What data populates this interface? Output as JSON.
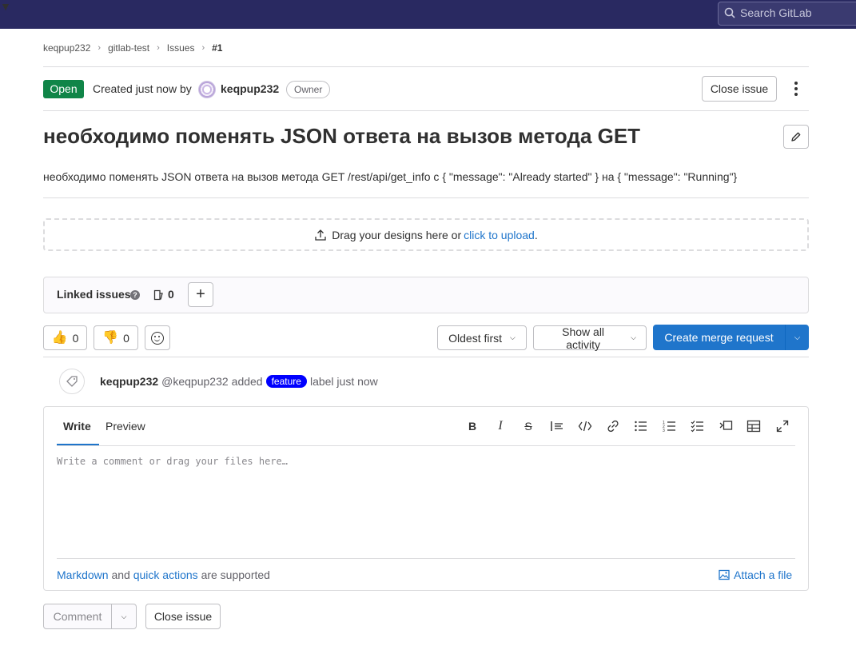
{
  "topbar": {
    "new_icon": "plus-square-icon",
    "search_placeholder": "Search GitLab"
  },
  "breadcrumb": [
    "keqpup232",
    "gitlab-test",
    "Issues",
    "#1"
  ],
  "issue": {
    "status": "Open",
    "created_text": "Created just now by",
    "author": "keqpup232",
    "role": "Owner",
    "close_label": "Close issue",
    "title": "необходимо поменять JSON ответа на вызов метода GET",
    "description": "необходимо поменять JSON ответа на вызов метода GET /rest/api/get_info с { \"message\": \"Already started\" } на { \"message\": \"Running\"}"
  },
  "designs": {
    "text": "Drag your designs here or",
    "link": "click to upload",
    "period": "."
  },
  "linked": {
    "title": "Linked issues",
    "help_glyph": "?",
    "count": "0",
    "add_glyph": "+"
  },
  "reactions": {
    "thumbsup": "👍",
    "thumbsup_count": "0",
    "thumbsdown": "👎",
    "thumbsdown_count": "0"
  },
  "sort": {
    "order": "Oldest first",
    "filter": "Show all activity"
  },
  "merge_request": {
    "label": "Create merge request"
  },
  "activity": {
    "author": "keqpup232",
    "handle": "@keqpup232",
    "action": "added",
    "label": "feature",
    "suffix": "label just now",
    "label_color": "#0000ff"
  },
  "editor": {
    "tab_write": "Write",
    "tab_preview": "Preview",
    "placeholder": "Write a comment or drag your files here…",
    "markdown": "Markdown",
    "and": "and",
    "quick_actions": "quick actions",
    "supported": "are supported",
    "attach": "Attach a file"
  },
  "actions": {
    "comment": "Comment",
    "close": "Close issue"
  },
  "colors": {
    "topbar": "#292961",
    "open_badge": "#108548",
    "primary": "#1f75cb"
  }
}
